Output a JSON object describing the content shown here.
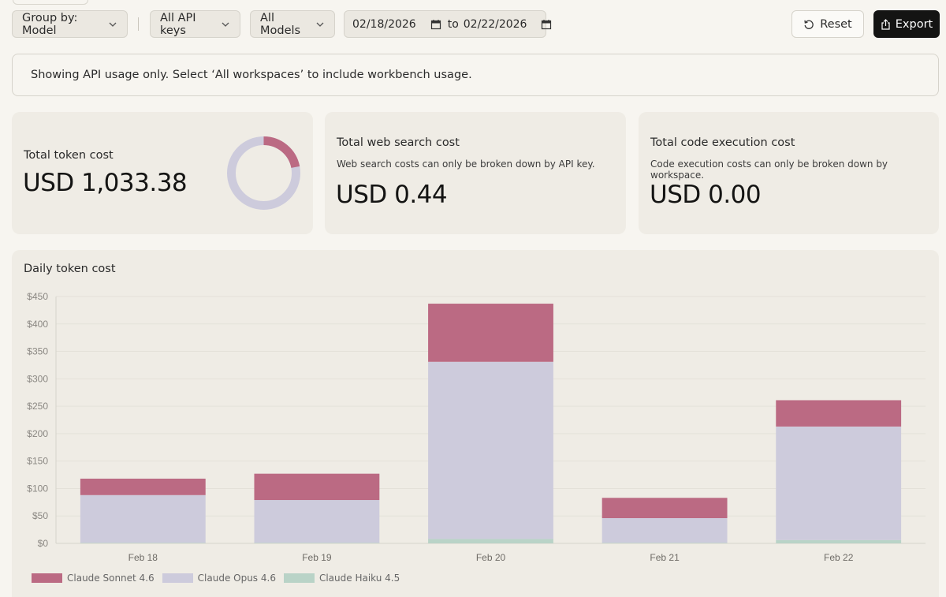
{
  "toolbar": {
    "group_by_label": "Group by: Model",
    "api_keys_label": "All API keys",
    "models_label": "All Models",
    "date_from": "02/18/2026",
    "date_to_word": "to",
    "date_to": "02/22/2026",
    "reset_label": "Reset",
    "export_label": "Export"
  },
  "banner": {
    "text": "Showing API usage only. Select ‘All workspaces’ to include workbench usage."
  },
  "cards": {
    "token": {
      "title": "Total token cost",
      "value": "USD 1,033.38"
    },
    "web_search": {
      "title": "Total web search cost",
      "subtitle": "Web search costs can only be broken down by API key.",
      "value": "USD 0.44"
    },
    "code_exec": {
      "title": "Total code execution cost",
      "subtitle": "Code execution costs can only be broken down by workspace.",
      "value": "USD 0.00"
    }
  },
  "donut": {
    "share_sonnet": 0.22,
    "colors": {
      "sonnet": "#bb6a83",
      "opus": "#cdcbdc"
    }
  },
  "chart_data": {
    "type": "bar",
    "stacked": true,
    "title": "Daily token cost",
    "categories": [
      "Feb 18",
      "Feb 19",
      "Feb 20",
      "Feb 21",
      "Feb 22"
    ],
    "series": [
      {
        "name": "Claude Haiku 4.5",
        "color": "#b9d3c7",
        "values": [
          1,
          1,
          8,
          1,
          6
        ]
      },
      {
        "name": "Claude Opus 4.6",
        "color": "#cdcbdc",
        "values": [
          87,
          78,
          323,
          45,
          207
        ]
      },
      {
        "name": "Claude Sonnet 4.6",
        "color": "#bb6a83",
        "values": [
          30,
          48,
          106,
          37,
          48
        ]
      }
    ],
    "legend_order": [
      "Claude Sonnet 4.6",
      "Claude Opus 4.6",
      "Claude Haiku 4.5"
    ],
    "y_ticks": [
      "$0",
      "$50",
      "$100",
      "$150",
      "$200",
      "$250",
      "$300",
      "$350",
      "$400",
      "$450"
    ],
    "ylim": [
      0,
      450
    ],
    "grid": true,
    "legend_position": "bottom-left"
  }
}
